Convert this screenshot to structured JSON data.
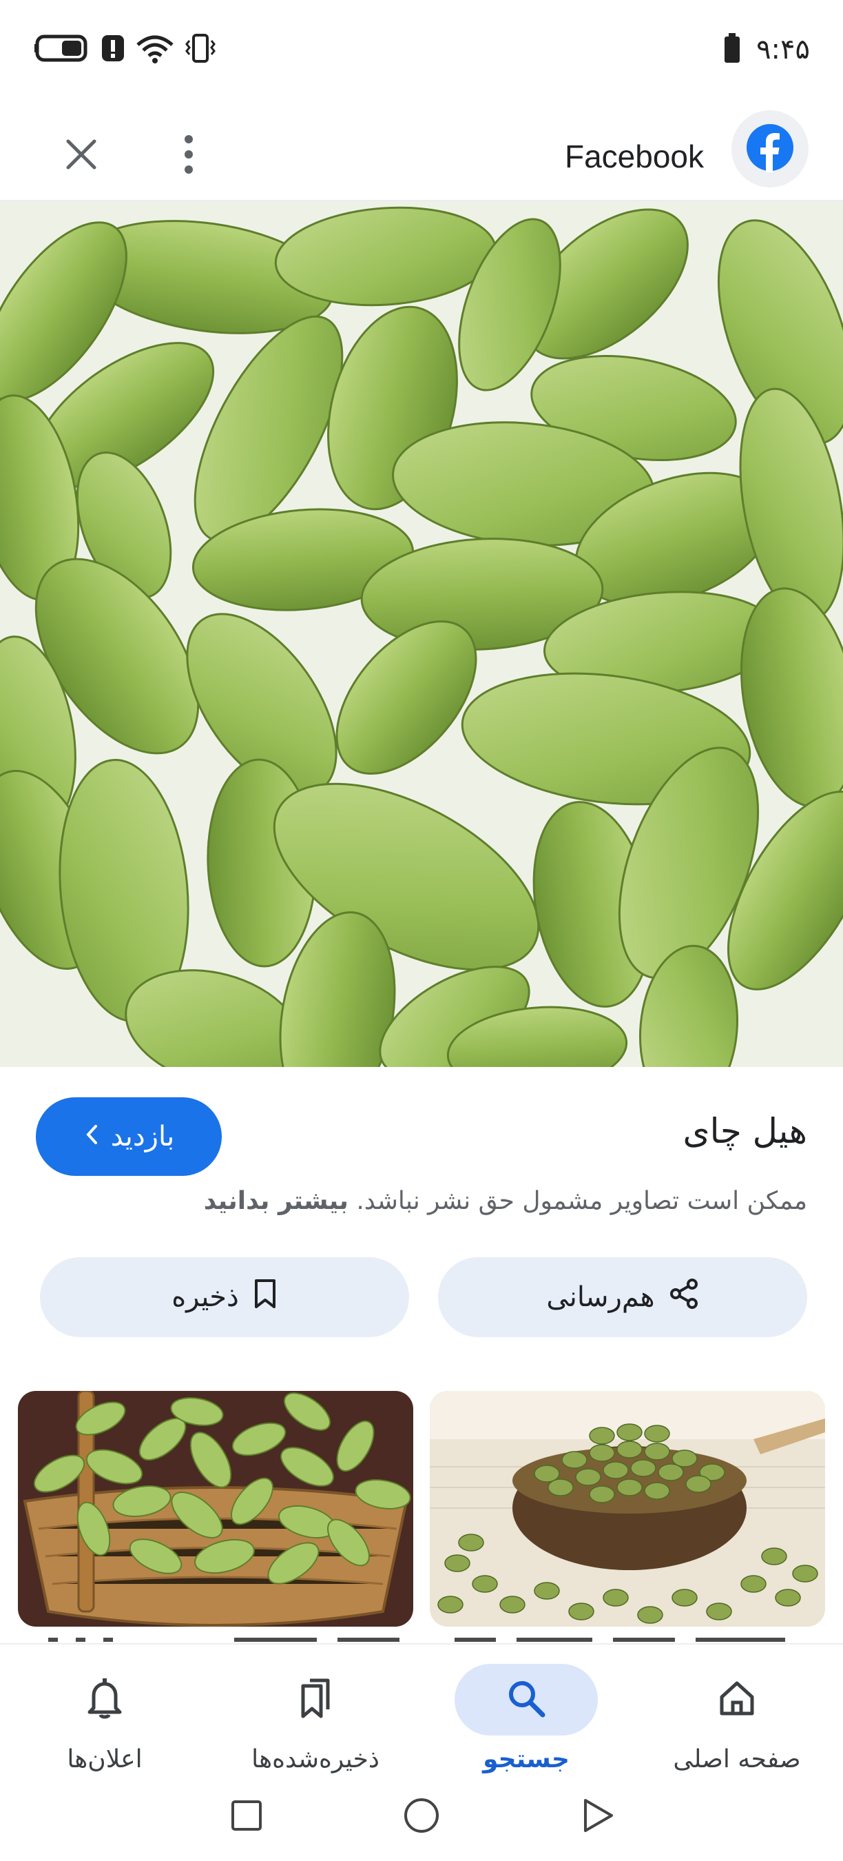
{
  "status_bar": {
    "time": "۹:۴۵",
    "icons": [
      "battery-icon",
      "alert-icon",
      "wifi-icon",
      "vibrate-icon",
      "battery-saver-icon"
    ]
  },
  "app_bar": {
    "source_name": "Facebook",
    "close_icon": "close-icon",
    "more_icon": "more-vert-icon",
    "source_logo": "facebook-logo"
  },
  "result": {
    "title": "هیل چای",
    "visit_label": "بازدید",
    "copyright_text": "ممکن است تصاویر مشمول حق نشر نباشد.",
    "learn_more": "بیشتر بدانید"
  },
  "actions": {
    "share_label": "هم‌رسانی",
    "save_label": "ذخیره"
  },
  "related": [
    {
      "name": "cardamom-in-spoon"
    },
    {
      "name": "cardamom-in-basket"
    }
  ],
  "bottom_nav": {
    "items": [
      {
        "label": "صفحه اصلی",
        "icon": "home-icon"
      },
      {
        "label": "جستجو",
        "icon": "search-icon",
        "active": true
      },
      {
        "label": "ذخیره‌شده‌ها",
        "icon": "bookmarks-icon"
      },
      {
        "label": "اعلان‌ها",
        "icon": "bell-icon"
      }
    ]
  },
  "colors": {
    "accent": "#1a73e8",
    "pill_bg": "#e8eef8",
    "nav_active_bg": "#dbe6fb",
    "facebook_blue": "#1877f2",
    "cardamom_green": "#9cbf5a"
  }
}
